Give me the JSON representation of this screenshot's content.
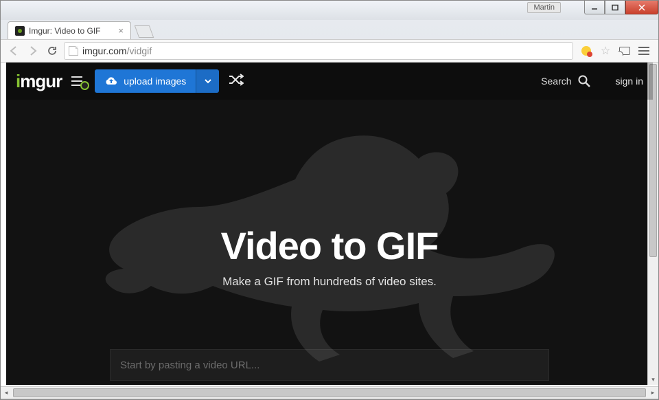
{
  "window": {
    "user_badge": "Martin"
  },
  "tab": {
    "title": "Imgur: Video to GIF"
  },
  "address": {
    "domain": "imgur.com",
    "path": "/vidgif"
  },
  "header": {
    "logo_prefix": "i",
    "logo_rest": "mgur",
    "upload_label": "upload images",
    "search_label": "Search",
    "signin_label": "sign in"
  },
  "hero": {
    "title": "Video to GIF",
    "subtitle": "Make a GIF from hundreds of video sites.",
    "input_placeholder": "Start by pasting a video URL..."
  }
}
